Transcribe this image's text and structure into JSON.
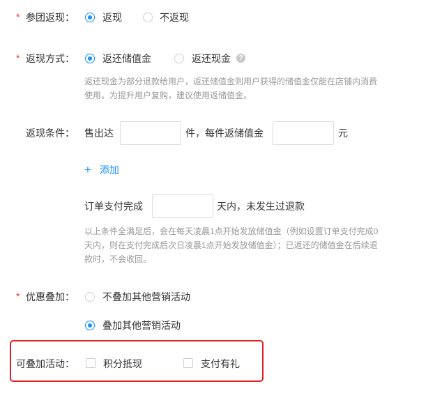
{
  "colors": {
    "accent": "#1890ff",
    "required": "#e33a3a",
    "highlight_frame": "#e02020",
    "help_text": "#999999"
  },
  "rebate_participation": {
    "required_mark": "*",
    "label": "参团返现：",
    "options": [
      {
        "label": "返现",
        "selected": true
      },
      {
        "label": "不返现",
        "selected": false
      }
    ]
  },
  "rebate_method": {
    "required_mark": "*",
    "label": "返现方式：",
    "options": [
      {
        "label": "返还储值金",
        "selected": true
      },
      {
        "label": "返还现金",
        "selected": false,
        "icon": "question-icon"
      }
    ],
    "question_glyph": "?",
    "help_line1": "返还现金为部分退款给用户，返还储值金则用户获得的储值金仅能在店铺内消费",
    "help_line2": "使用。为提升用户复购，建议使用返储值金。"
  },
  "rebate_condition": {
    "label": "返现条件：",
    "sold_prefix": "售出达",
    "sold_value": "",
    "per_item_text": "件，每件返储值金",
    "amount_value": "",
    "currency_unit": "元",
    "add_icon": "plus-icon",
    "add_glyph": "+",
    "add_label": "添加",
    "order_prefix": "订单支付完成",
    "days_value": "",
    "order_suffix": "天内，未发生过退款",
    "help_line1": "以上条件全满足后，会在每天凌晨1点开始发放储值金（例如设置订单支付完成0",
    "help_line2": "天内，则在支付完成后次日凌晨1点开始发放储值金）；已返还的储值金在后续退",
    "help_line3": "款时，不会收回。"
  },
  "discount_stacking": {
    "required_mark": "*",
    "label": "优惠叠加：",
    "options": [
      {
        "label": "不叠加其他营销活动",
        "selected": false
      },
      {
        "label": "叠加其他营销活动",
        "selected": true
      }
    ]
  },
  "stackable_activities": {
    "label": "可叠加活动：",
    "options": [
      {
        "label": "积分抵现",
        "checked": false
      },
      {
        "label": "支付有礼",
        "checked": false
      }
    ]
  }
}
